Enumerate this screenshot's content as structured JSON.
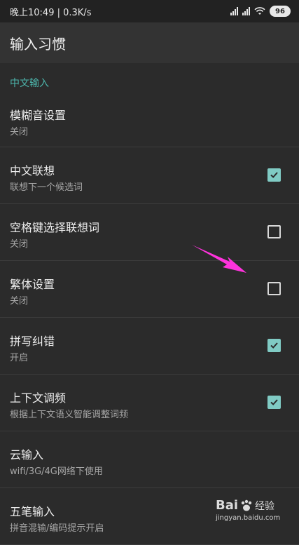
{
  "status_bar": {
    "time_speed": "晚上10:49 | 0.3K/s",
    "battery": "96"
  },
  "app_bar": {
    "title": "输入习惯"
  },
  "section": {
    "header": "中文输入"
  },
  "settings": [
    {
      "title": "模糊音设置",
      "subtitle": "关闭",
      "has_checkbox": false,
      "checked": false
    },
    {
      "title": "中文联想",
      "subtitle": "联想下一个候选词",
      "has_checkbox": true,
      "checked": true
    },
    {
      "title": "空格键选择联想词",
      "subtitle": "关闭",
      "has_checkbox": true,
      "checked": false
    },
    {
      "title": "繁体设置",
      "subtitle": "关闭",
      "has_checkbox": true,
      "checked": false
    },
    {
      "title": "拼写纠错",
      "subtitle": "开启",
      "has_checkbox": true,
      "checked": true
    },
    {
      "title": "上下文调频",
      "subtitle": "根据上下文语义智能调整词频",
      "has_checkbox": true,
      "checked": true
    },
    {
      "title": "云输入",
      "subtitle": "wifi/3G/4G网络下使用",
      "has_checkbox": false,
      "checked": false
    },
    {
      "title": "五笔输入",
      "subtitle": "拼音混输/编码提示开启",
      "has_checkbox": false,
      "checked": false
    }
  ],
  "watermark": {
    "brand": "Bai",
    "brand_suffix": "经验",
    "url": "jingyan.baidu.com"
  },
  "colors": {
    "accent": "#4db6ac",
    "checkbox_checked": "#80cbc4",
    "arrow": "#ff33dd",
    "background": "#2b2b2b"
  }
}
